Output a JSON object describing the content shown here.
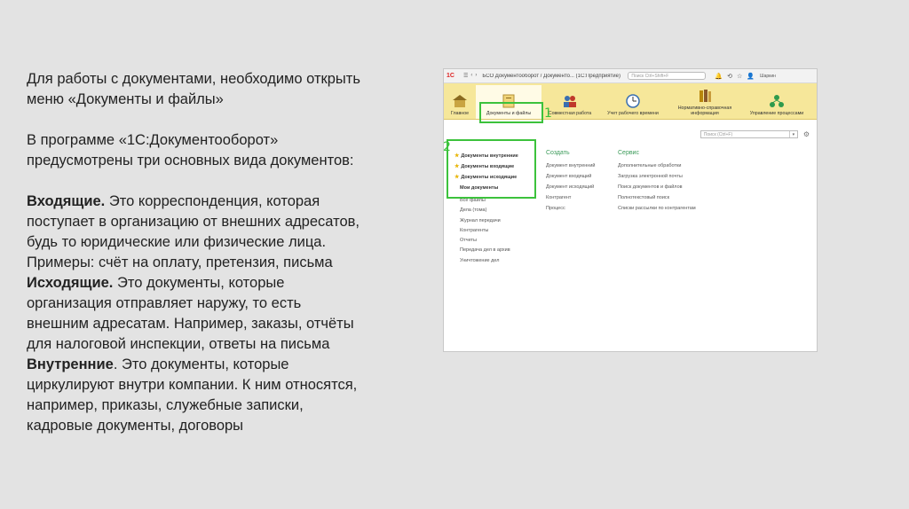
{
  "slide": {
    "intro_line1": "Для работы с документами, необходимо открыть",
    "intro_line2": "меню «Документы и файлы»",
    "para2_line1": "В программе «1С:Документооборот»",
    "para2_line2": "предусмотрены три основных вида документов:",
    "incoming_title": "Входящие.",
    "incoming_line1": " Это корреспонденция, которая",
    "incoming_line2": "поступает в организацию от внешних адресатов,",
    "incoming_line3": "будь то юридические или физические лица.",
    "incoming_line4": "Примеры: счёт на оплату, претензия, письма",
    "outgoing_title": "Исходящие.",
    "outgoing_line1": " Это документы, которые",
    "outgoing_line2": "организация отправляет наружу, то есть",
    "outgoing_line3": "внешним адресатам. Например, заказы, отчёты",
    "outgoing_line4": "для налоговой инспекции, ответы на письма",
    "internal_title": "Внутренние",
    "internal_line1": ". Это документы, которые",
    "internal_line2": "циркулируют внутри компании. К ним относятся,",
    "internal_line3": "например, приказы, служебные записки,",
    "internal_line4": "кадровые документы, договоры"
  },
  "screenshot": {
    "window_title": "БСО Документооборот / Документо... (1С:Предприятие)",
    "logo_text": "1С",
    "title_search_placeholder": "Поиск Ctrl+Shift+F",
    "user_label": "Шаркин",
    "toolbar": [
      {
        "label": "Главное",
        "icon": "home-icon"
      },
      {
        "label": "Документы и файлы",
        "icon": "folder-icon"
      },
      {
        "label": "Совместная работа",
        "icon": "people-icon"
      },
      {
        "label": "Учет рабочего времени",
        "icon": "clock-icon"
      },
      {
        "label": "Нормативно-справочная информация",
        "icon": "books-icon"
      },
      {
        "label": "Управление процессами",
        "icon": "process-icon"
      }
    ],
    "annotation_1": "1",
    "annotation_2": "2",
    "search_placeholder": "Поиск (Ctrl+F)",
    "left_starred": [
      "Документы внутренние",
      "Документы входящие",
      "Документы исходящие"
    ],
    "left_bold": "Мои документы",
    "left_plain": [
      "Все файлы",
      "Дела (тома)",
      "Журнал передачи",
      "Контрагенты",
      "Отчеты",
      "Передача дел в архив",
      "Уничтожение дел"
    ],
    "create_head": "Создать",
    "create_items": [
      "Документ внутренний",
      "Документ входящий",
      "Документ исходящий",
      "Контрагент",
      "Процесс"
    ],
    "service_head": "Сервис",
    "service_items": [
      "Дополнительные обработки",
      "Загрузка электронной почты",
      "Поиск документов и файлов",
      "Полнотекстовый поиск",
      "Списки рассылки по контрагентам"
    ]
  },
  "colors": {
    "accent_green": "#3cc23c",
    "toolbar_yellow": "#f6e79a",
    "section_green": "#3c9b5a",
    "star_yellow": "#e8b400"
  }
}
